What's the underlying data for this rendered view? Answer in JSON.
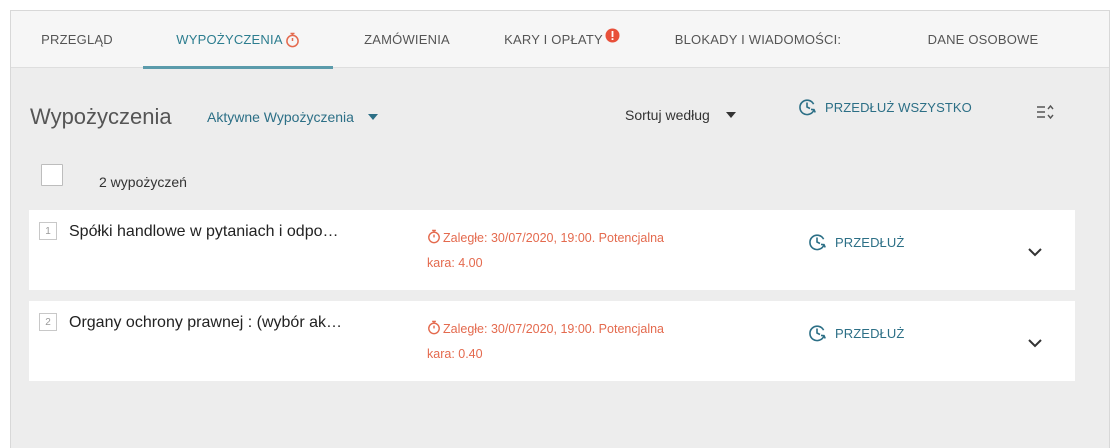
{
  "tabs": [
    {
      "label": "PRZEGLĄD",
      "active": false
    },
    {
      "label": "WYPOŻYCZENIA",
      "active": true,
      "icon": "stopwatch-icon"
    },
    {
      "label": "ZAMÓWIENIA",
      "active": false
    },
    {
      "label": "KARY I OPŁATY",
      "active": false,
      "icon": "alert-badge-icon"
    },
    {
      "label": "BLOKADY I WIADOMOŚCI:",
      "active": false
    },
    {
      "label": "DANE OSOBOWE",
      "active": false
    }
  ],
  "toolbar": {
    "title": "Wypożyczenia",
    "filter_value": "Aktywne Wypożyczenia",
    "sort_label": "Sortuj według",
    "renew_all_label": "PRZEDŁUŻ WSZYSTKO"
  },
  "list": {
    "count_label": "2 wypożyczeń",
    "items": [
      {
        "number": "1",
        "title": "Spółki handlowe w pytaniach i odpo…",
        "due_line1": "Zaległe: 30/07/2020, 19:00. Potencjalna",
        "due_line2": "kara: 4.00",
        "renew_label": "PRZEDŁUŻ"
      },
      {
        "number": "2",
        "title": "Organy ochrony prawnej : (wybór ak…",
        "due_line1": "Zaległe: 30/07/2020, 19:00. Potencjalna",
        "due_line2": "kara: 0.40",
        "renew_label": "PRZEDŁUŻ"
      }
    ]
  },
  "colors": {
    "accent": "#2c6f86",
    "tab_active": "#2c7d8f",
    "overdue": "#e46a4e",
    "alert_badge": "#e8503a"
  }
}
